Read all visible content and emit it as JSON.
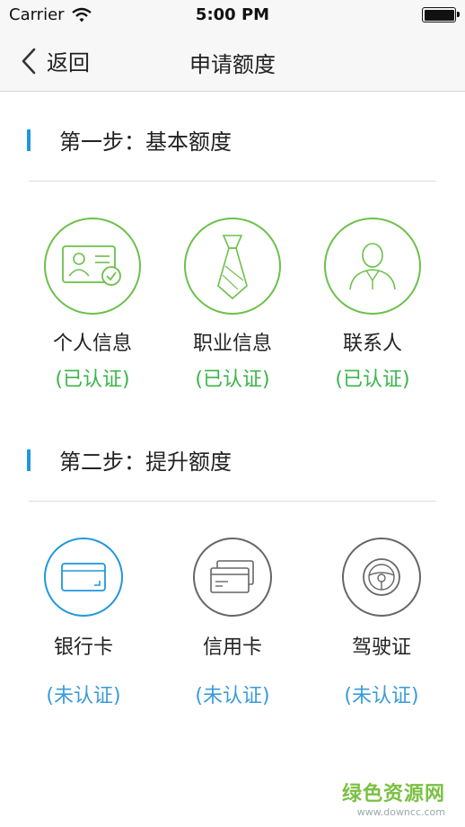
{
  "status_bar": {
    "carrier": "Carrier",
    "time": "5:00 PM"
  },
  "nav": {
    "back_label": "返回",
    "title": "申请额度"
  },
  "step1": {
    "title": "第一步：基本额度",
    "items": [
      {
        "name": "个人信息",
        "status": "(已认证)",
        "icon": "id-card-icon"
      },
      {
        "name": "职业信息",
        "status": "(已认证)",
        "icon": "necktie-icon"
      },
      {
        "name": "联系人",
        "status": "(已认证)",
        "icon": "contact-person-icon"
      }
    ]
  },
  "step2": {
    "title": "第二步：提升额度",
    "items": [
      {
        "name": "银行卡",
        "status": "(未认证)",
        "icon": "bank-card-icon"
      },
      {
        "name": "信用卡",
        "status": "(未认证)",
        "icon": "credit-card-icon"
      },
      {
        "name": "驾驶证",
        "status": "(未认证)",
        "icon": "steering-wheel-icon"
      }
    ]
  },
  "watermark": {
    "main": "绿色资源网",
    "sub": "www.downcc.com"
  },
  "colors": {
    "accent_blue": "#1f97e0",
    "verified_green": "#39b54a",
    "icon_green": "#6cc04a",
    "unverified_blue": "#3a9bd8"
  }
}
